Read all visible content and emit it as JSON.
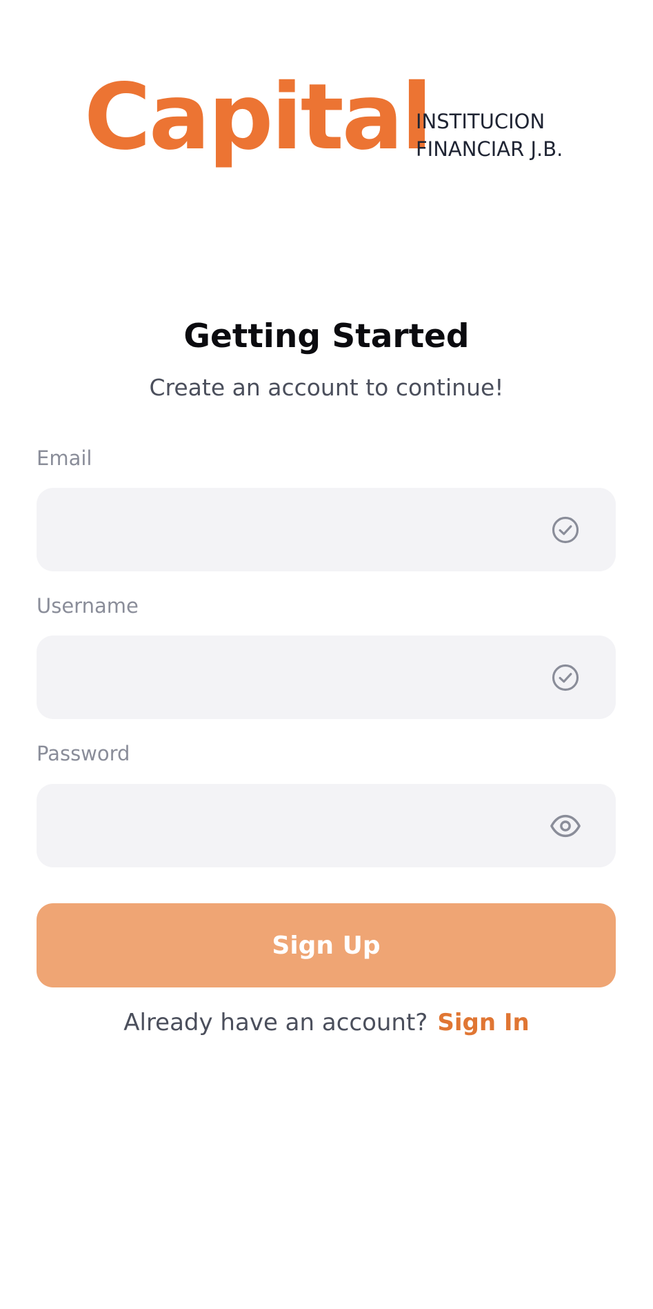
{
  "logo": {
    "wordmark": "Capital",
    "subtitle_line1": "INSTITUCION",
    "subtitle_line2": "FINANCIAR J.B."
  },
  "header": {
    "title": "Getting Started",
    "subtitle": "Create an account to continue!"
  },
  "form": {
    "email": {
      "label": "Email",
      "value": "",
      "placeholder": "",
      "icon": "check-circle-icon"
    },
    "username": {
      "label": "Username",
      "value": "",
      "placeholder": "",
      "icon": "check-circle-icon"
    },
    "password": {
      "label": "Password",
      "value": "",
      "placeholder": "",
      "icon": "eye-icon"
    },
    "submit_label": "Sign Up"
  },
  "footer": {
    "prompt": "Already have an account?",
    "link_label": "Sign In"
  },
  "colors": {
    "brand_orange": "#ec7433",
    "button_fill": "#efa574",
    "field_bg": "#f3f3f6",
    "icon_gray": "#8a8d99"
  }
}
